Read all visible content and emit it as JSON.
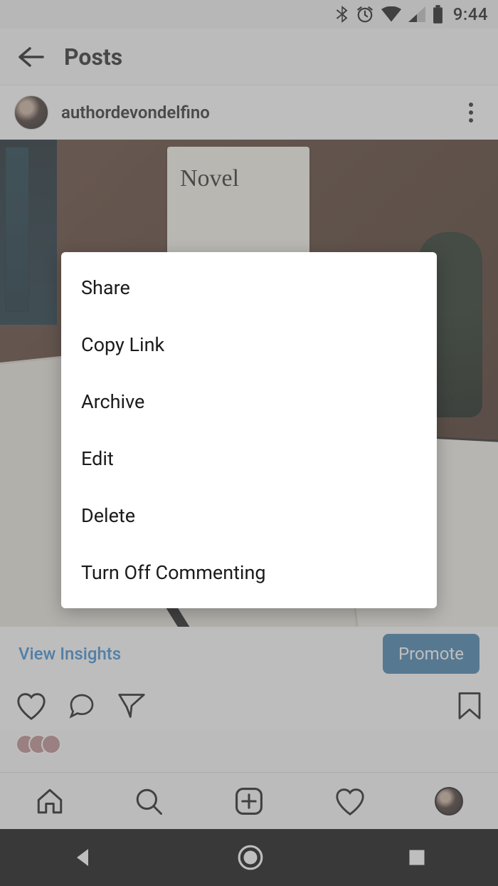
{
  "status": {
    "time": "9:44"
  },
  "header": {
    "title": "Posts"
  },
  "post": {
    "username": "authordevondelfino",
    "image_card_text": "Novel"
  },
  "insights": {
    "view_label": "View Insights",
    "promote_label": "Promote"
  },
  "menu": {
    "items": [
      {
        "label": "Share"
      },
      {
        "label": "Copy Link"
      },
      {
        "label": "Archive"
      },
      {
        "label": "Edit"
      },
      {
        "label": "Delete"
      },
      {
        "label": "Turn Off Commenting"
      }
    ]
  }
}
